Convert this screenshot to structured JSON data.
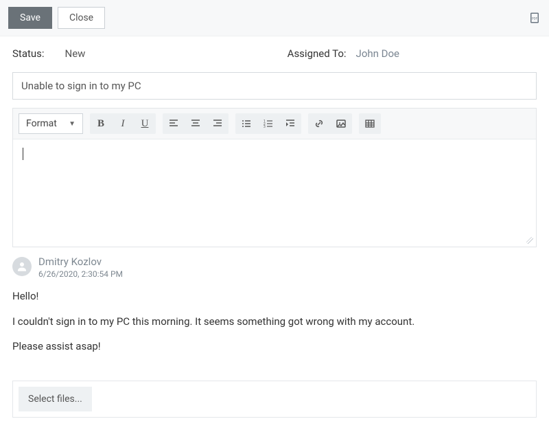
{
  "topbar": {
    "save_label": "Save",
    "close_label": "Close"
  },
  "meta": {
    "status_label": "Status:",
    "status_value": "New",
    "assigned_label": "Assigned To:",
    "assigned_value": "John Doe"
  },
  "subject": {
    "value": "Unable to sign in to my PC"
  },
  "editor_toolbar": {
    "format_label": "Format"
  },
  "comment": {
    "author": "Dmitry Kozlov",
    "timestamp": "6/26/2020, 2:30:54 PM",
    "body_lines": [
      "Hello!",
      "I couldn't sign in to my PC this morning. It seems something got wrong with my account.",
      "Please assist asap!"
    ]
  },
  "upload": {
    "select_files_label": "Select files..."
  }
}
